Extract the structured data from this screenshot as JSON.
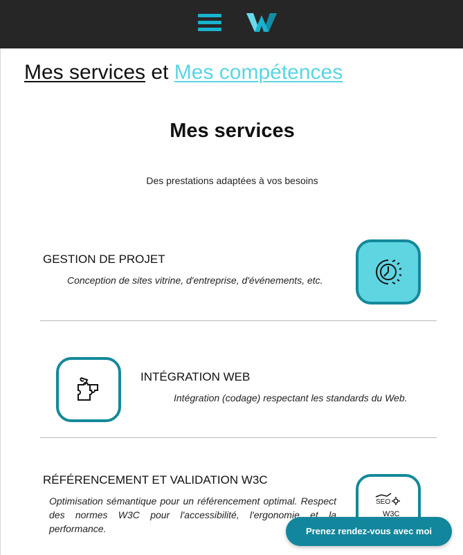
{
  "header": {
    "menu_icon": "hamburger-menu-icon",
    "logo_icon": "wm-logo-icon",
    "accent": "#18b3cf",
    "background": "#262626"
  },
  "toggle": {
    "services_label": "Mes services",
    "separator": "et",
    "skills_label": "Mes compétences"
  },
  "main": {
    "title": "Mes services",
    "subtitle": "Des prestations adaptées à vos besoins"
  },
  "services": [
    {
      "title": "GESTION DE PROJET",
      "description": "Conception de sites vitrine, d'entreprise, d'événements, etc.",
      "icon": "clock-gear-icon"
    },
    {
      "title": "INTÉGRATION WEB",
      "description": "Intégration (codage) respectant les standards du Web.",
      "icon": "puzzle-icon"
    },
    {
      "title": "RÉFÉRENCEMENT ET VALIDATION W3C",
      "description": "Optimisation sémantique pour un référencement optimal. Respect des normes W3C pour l'accessibilité, l'ergonomie et la performance.",
      "icon": "seo-w3c-icon",
      "icon_text_seo": "SEO",
      "icon_text_w3c": "W3C"
    }
  ],
  "cta": {
    "label": "Prenez rendez-vous avec moi"
  },
  "colors": {
    "teal_dark": "#13899a",
    "teal_light": "#5fd5e1",
    "cta": "#12869c"
  }
}
